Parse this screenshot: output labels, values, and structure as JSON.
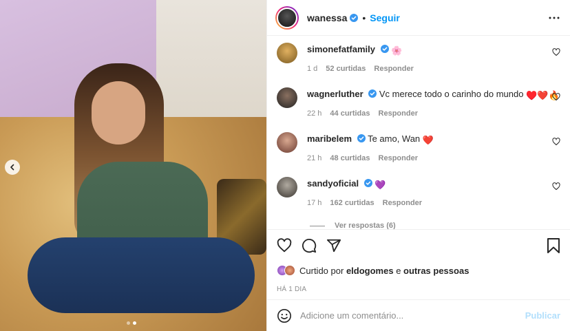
{
  "post": {
    "author": "wanessa",
    "follow_label": "Seguir",
    "separator": "•",
    "time_label": "HÁ 1 DIA"
  },
  "comments": [
    {
      "user": "simonefatfamily",
      "text": "",
      "emoji": "🌸",
      "time": "1 d",
      "likes": "52 curtidas",
      "reply": "Responder"
    },
    {
      "user": "wagnerluther",
      "text": "Vc merece todo o carinho do mundo",
      "emoji": "♥️❤️🔥",
      "time": "22 h",
      "likes": "44 curtidas",
      "reply": "Responder"
    },
    {
      "user": "maribelem",
      "text": "Te amo, Wan",
      "emoji": "❤️",
      "time": "21 h",
      "likes": "48 curtidas",
      "reply": "Responder"
    },
    {
      "user": "sandyoficial",
      "text": "",
      "emoji": "💜",
      "time": "17 h",
      "likes": "162 curtidas",
      "reply": "Responder"
    }
  ],
  "view_replies": "Ver respostas (6)",
  "liked_by": {
    "prefix": "Curtido por",
    "user": "eldogomes",
    "connector": "e",
    "others": "outras pessoas"
  },
  "add_comment": {
    "placeholder": "Adicione um comentário...",
    "publish_label": "Publicar"
  },
  "icons": {
    "carousel_prev": "chevron-left-icon",
    "more": "more-options-icon",
    "like": "heart-icon",
    "comment": "comment-icon",
    "share": "share-icon",
    "save": "bookmark-icon",
    "emoji": "emoji-icon",
    "verified": "verified-badge-icon"
  },
  "colors": {
    "accent": "#0095f6",
    "verified": "#3897f0",
    "muted": "#8e8e8e",
    "publish_disabled": "#b2dffc"
  }
}
